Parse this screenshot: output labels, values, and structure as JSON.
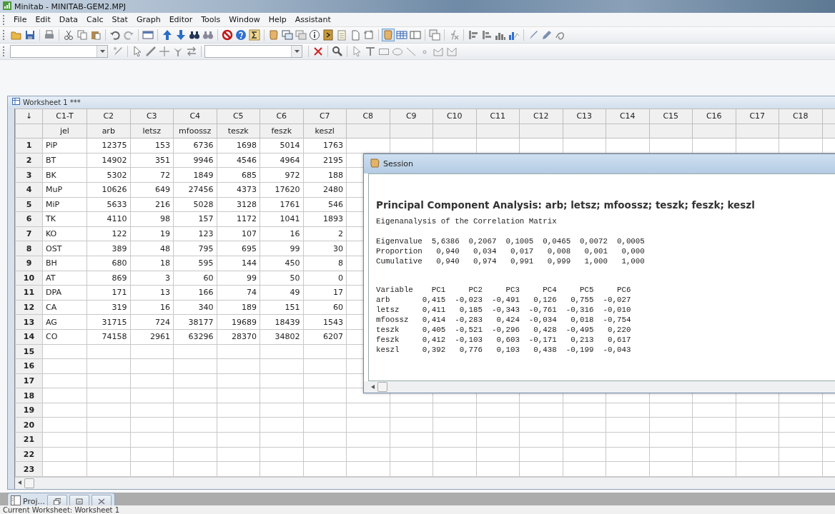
{
  "window": {
    "title": "Minitab - MINITAB-GEM2.MPJ"
  },
  "menu": [
    "File",
    "Edit",
    "Data",
    "Calc",
    "Stat",
    "Graph",
    "Editor",
    "Tools",
    "Window",
    "Help",
    "Assistant"
  ],
  "worksheet": {
    "title": "Worksheet 1 ***",
    "corner": "↓",
    "columns": [
      {
        "id": "C1-T",
        "name": "jel"
      },
      {
        "id": "C2",
        "name": "arb"
      },
      {
        "id": "C3",
        "name": "letsz"
      },
      {
        "id": "C4",
        "name": "mfoossz"
      },
      {
        "id": "C5",
        "name": "teszk"
      },
      {
        "id": "C6",
        "name": "feszk"
      },
      {
        "id": "C7",
        "name": "keszl"
      },
      {
        "id": "C8"
      },
      {
        "id": "C9"
      },
      {
        "id": "C10"
      },
      {
        "id": "C11"
      },
      {
        "id": "C12"
      },
      {
        "id": "C13"
      },
      {
        "id": "C14"
      },
      {
        "id": "C15"
      },
      {
        "id": "C16"
      },
      {
        "id": "C17"
      },
      {
        "id": "C18"
      }
    ],
    "row_numbers": [
      "1",
      "2",
      "3",
      "4",
      "5",
      "6",
      "7",
      "8",
      "9",
      "10",
      "11",
      "12",
      "13",
      "14",
      "15",
      "16",
      "17",
      "18",
      "19",
      "20",
      "21",
      "22",
      "23"
    ],
    "rows": [
      [
        "PiP",
        "12375",
        "153",
        "6736",
        "1698",
        "5014",
        "1763"
      ],
      [
        "BT",
        "14902",
        "351",
        "9946",
        "4546",
        "4964",
        "2195"
      ],
      [
        "BK",
        "5302",
        "72",
        "1849",
        "685",
        "972",
        "188"
      ],
      [
        "MuP",
        "10626",
        "649",
        "27456",
        "4373",
        "17620",
        "2480"
      ],
      [
        "MiP",
        "5633",
        "216",
        "5028",
        "3128",
        "1761",
        "546"
      ],
      [
        "TK",
        "4110",
        "98",
        "157",
        "1172",
        "1041",
        "1893"
      ],
      [
        "KO",
        "122",
        "19",
        "123",
        "107",
        "16",
        "2"
      ],
      [
        "OST",
        "389",
        "48",
        "795",
        "695",
        "99",
        "30"
      ],
      [
        "BH",
        "680",
        "18",
        "595",
        "144",
        "450",
        "8"
      ],
      [
        "AT",
        "869",
        "3",
        "60",
        "99",
        "50",
        "0"
      ],
      [
        "DPA",
        "171",
        "13",
        "166",
        "74",
        "49",
        "17"
      ],
      [
        "CA",
        "319",
        "16",
        "340",
        "189",
        "151",
        "60"
      ],
      [
        "AG",
        "31715",
        "724",
        "38177",
        "19689",
        "18439",
        "1543"
      ],
      [
        "CO",
        "74158",
        "2961",
        "63296",
        "28370",
        "34802",
        "6207"
      ]
    ]
  },
  "session": {
    "title": "Session",
    "heading": "Principal Component Analysis: arb; letsz; mfoossz; teszk; feszk; keszl",
    "subheading": "Eigenanalysis of the Correlation Matrix",
    "eigen_lines": [
      "Eigenvalue  5,6386  0,2067  0,1005  0,0465  0,0072  0,0005",
      "Proportion   0,940   0,034   0,017   0,008   0,001   0,000",
      "Cumulative   0,940   0,974   0,991   0,999   1,000   1,000"
    ],
    "loading_lines": [
      "Variable    PC1     PC2     PC3     PC4     PC5     PC6",
      "arb       0,415  -0,023  -0,491   0,126   0,755  -0,027",
      "letsz     0,411   0,185  -0,343  -0,761  -0,316  -0,010",
      "mfoossz   0,414  -0,283   0,424  -0,034   0,018  -0,754",
      "teszk     0,405  -0,521  -0,296   0,428  -0,495   0,220",
      "feszk     0,412  -0,103   0,603  -0,171   0,213   0,617",
      "keszl     0,392   0,776   0,103   0,438  -0,199  -0,043"
    ]
  },
  "project_tab": {
    "label": "Proj..."
  },
  "status_bar": "Current Worksheet: Worksheet 1"
}
